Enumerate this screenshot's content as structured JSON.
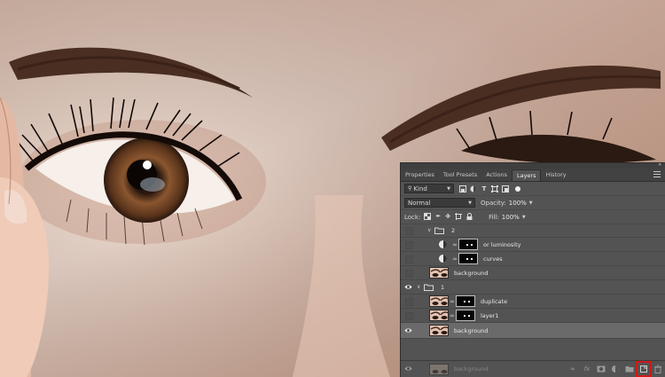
{
  "tabs": [
    "Properties",
    "Tool Presets",
    "Actions",
    "Layers",
    "History"
  ],
  "active_tab": "Layers",
  "filter": {
    "kind_label": "Kind"
  },
  "blend": {
    "mode": "Normal",
    "opacity_label": "Opacity:",
    "opacity_value": "100%"
  },
  "lock": {
    "label": "Lock:",
    "fill_label": "Fill:",
    "fill_value": "100%"
  },
  "layers": [
    {
      "name": "2",
      "kind": "group",
      "visible": false,
      "indent": 0
    },
    {
      "name": "or luminosity",
      "kind": "adjustment",
      "visible": false,
      "indent": 1
    },
    {
      "name": "curves",
      "kind": "adjustment",
      "visible": false,
      "indent": 1
    },
    {
      "name": "background",
      "kind": "pixel",
      "visible": false,
      "indent": 1
    },
    {
      "name": "1",
      "kind": "group",
      "visible": true,
      "indent": 0
    },
    {
      "name": "duplicate",
      "kind": "masked",
      "visible": false,
      "indent": 1
    },
    {
      "name": "layer1",
      "kind": "masked",
      "visible": false,
      "indent": 1
    },
    {
      "name": "background",
      "kind": "pixel",
      "visible": true,
      "indent": 0,
      "selected": true
    }
  ],
  "ghost_layer": {
    "name": "background"
  },
  "bottom_icons": [
    "link-icon",
    "fx-icon",
    "mask-icon",
    "adjustment-icon",
    "folder-icon",
    "new-layer-icon",
    "trash-icon"
  ],
  "highlight_color": "#d01818"
}
